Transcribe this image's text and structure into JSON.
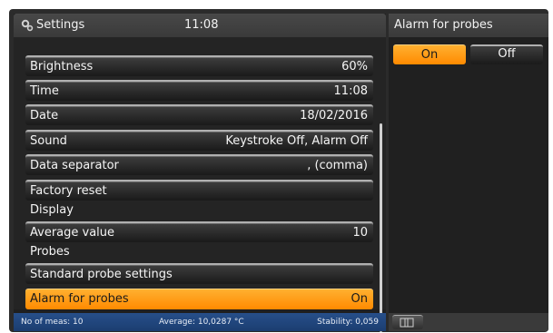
{
  "settings": {
    "title": "Settings",
    "clock": "11:08",
    "items": [
      {
        "label": "Brightness",
        "value": "60%"
      },
      {
        "label": "Time",
        "value": "11:08"
      },
      {
        "label": "Date",
        "value": "18/02/2016"
      },
      {
        "label": "Sound",
        "value": "Keystroke Off, Alarm Off"
      },
      {
        "label": "Data separator",
        "value": ", (comma)"
      },
      {
        "label": "Factory reset",
        "value": ""
      },
      {
        "label": "Display"
      },
      {
        "label": "Average value",
        "value": "10"
      },
      {
        "label": "Probes"
      },
      {
        "label": "Standard probe settings",
        "value": ""
      },
      {
        "label": "Alarm for probes",
        "value": "On"
      }
    ]
  },
  "status": {
    "meas": "No of meas: 10",
    "average": "Average: 10,0287 °C",
    "stability": "Stability: 0,059"
  },
  "right_panel": {
    "title": "Alarm for probes",
    "on_label": "On",
    "off_label": "Off",
    "selected": "On"
  },
  "colors": {
    "accent": "#ff9a10",
    "status_bar": "#1e447b",
    "background": "#2b2b2b"
  },
  "icons": {
    "header": "gear-icon",
    "footer": "back-icon"
  }
}
